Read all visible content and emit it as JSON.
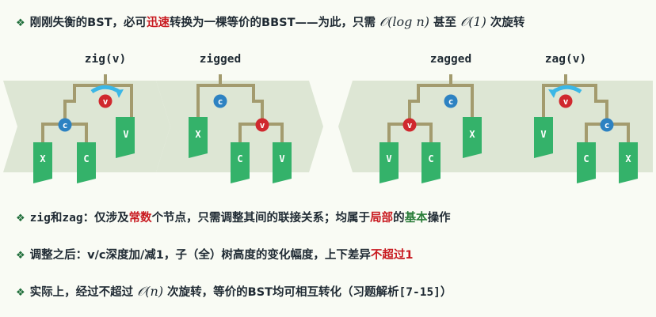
{
  "bullets": [
    {
      "pre": "刚刚失衡的BST，必可",
      "hi": "迅速",
      "mid": "转换为一棵等价的BBST——为此，只需 ",
      "m1": "𝒪(log n)",
      "mid2": " 甚至 ",
      "m2": "𝒪(1)",
      "post": " 次旋转"
    },
    {
      "a": "zig",
      "b": "和",
      "c": "zag",
      "d": "：仅涉及",
      "e": "常数",
      "f": "个节点，只需调整其间的联接关系；均属于",
      "g": "局部",
      "h": "的",
      "i": "基本",
      "j": "操作"
    },
    {
      "a": "调整之后：v/c深度加/减1，子（全）树高度的变化幅度，上下差异",
      "b": "不超过",
      "c": "1"
    },
    {
      "a": "实际上，经过不超过 ",
      "m": "𝒪(n)",
      "b": " 次旋转，等价的BST均可相互转化（习题解析",
      "c": "[7-15]",
      "d": "）"
    }
  ],
  "labels": {
    "zig": "zig(v)",
    "zigged": "zigged",
    "zagged": "zagged",
    "zag": "zag(v)"
  },
  "node_v": "v",
  "node_c": "c",
  "leaf_X": "X",
  "leaf_C": "C",
  "leaf_V": "V",
  "colors": {
    "node_v": "#d0282e",
    "node_c": "#2d82c2",
    "leaf": "#34b26a",
    "edge": "#a39b6e",
    "panel": "#dde6d4",
    "arrow": "#3bb7e6"
  }
}
